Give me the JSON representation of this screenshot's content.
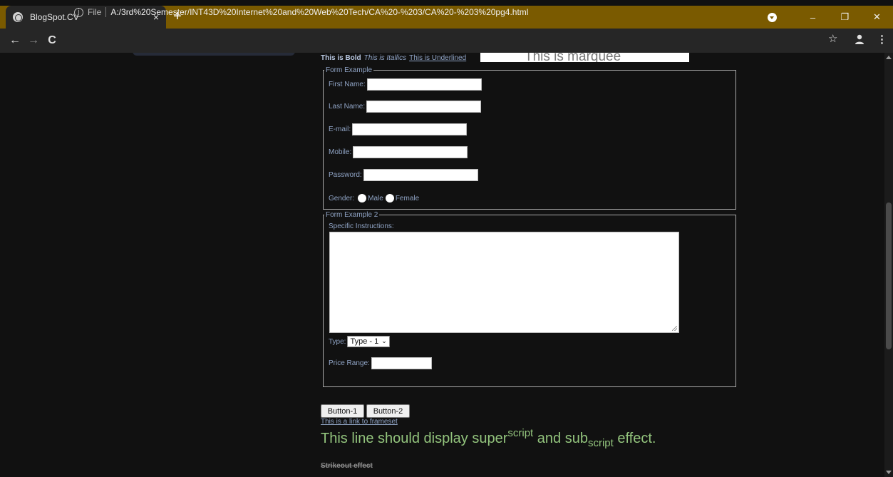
{
  "browser": {
    "tab_title": "BlogSpot.CV",
    "tab_close": "×",
    "new_tab": "+",
    "file_label": "File",
    "url": "A:/3rd%20Semester/INT43D%20Internet%20and%20Web%20Tech/CA%20-%203/CA%20-%203%20pg4.html",
    "icons": [
      "globe-icon",
      "close-icon",
      "plus-icon",
      "back-icon",
      "forward-icon",
      "reload-icon",
      "info-icon",
      "star-icon",
      "account-icon",
      "kebab-menu-icon",
      "minimize-icon",
      "restore-icon",
      "window-close-icon"
    ],
    "accent_color": "#7a5a00"
  },
  "page": {
    "bold_text": "This is Bold",
    "italic_text": "This is Itallics",
    "underline_text": "This is Underlined",
    "marquee_text": "This is marquee",
    "form1": {
      "legend": "Form Example",
      "first_name_label": "First Name:",
      "last_name_label": "Last Name:",
      "email_label": "E-mail:",
      "mobile_label": "Mobile:",
      "password_label": "Password:",
      "gender_label": "Gender:",
      "male_label": "Male",
      "female_label": "Female"
    },
    "form2": {
      "legend": "Form Example 2",
      "instructions_label": "Specific Instructions:",
      "type_label": "Type:",
      "type_selected": "Type - 1",
      "price_label": "Price Range:"
    },
    "button1": "Button-1",
    "button2": "Button-2",
    "frameset_link": "This is a link to frameset",
    "supsub": {
      "part1": "This line should display super",
      "sup": "script",
      "part2": " and sub",
      "sub": "script",
      "part3": " effect."
    },
    "strikeout": "Strikeout effect"
  }
}
